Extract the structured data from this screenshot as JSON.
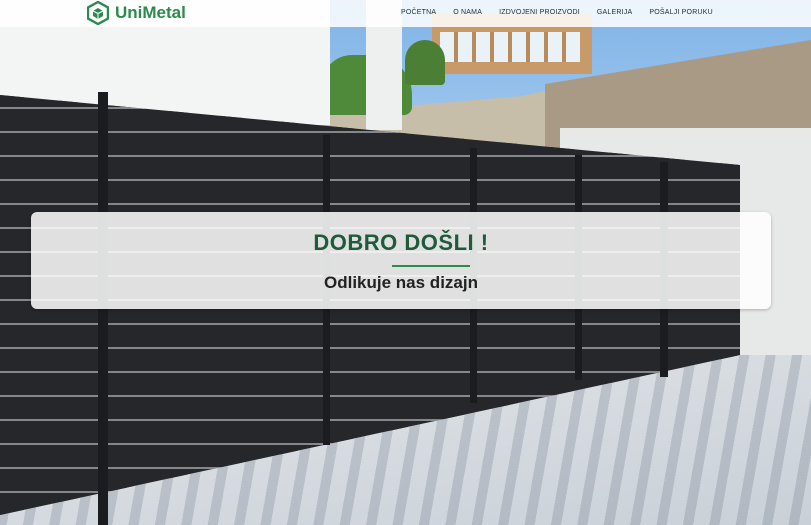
{
  "brand": {
    "name": "UniMetal",
    "color": "#2d8a4e",
    "logo_icon": "hexagon-cube-logo-icon"
  },
  "nav": {
    "items": [
      {
        "label": "POČETNA"
      },
      {
        "label": "O NAMA"
      },
      {
        "label": "IZDVOJENI PROIZVODI"
      },
      {
        "label": "GALERIJA"
      },
      {
        "label": "POŠALJI PORUKU"
      }
    ]
  },
  "hero": {
    "title": "DOBRO DOŠLI !",
    "subtitle": "Odlikuje nas dizajn",
    "title_color": "#1f5a3a",
    "background": "photo-black-perforated-sliding-gate"
  }
}
